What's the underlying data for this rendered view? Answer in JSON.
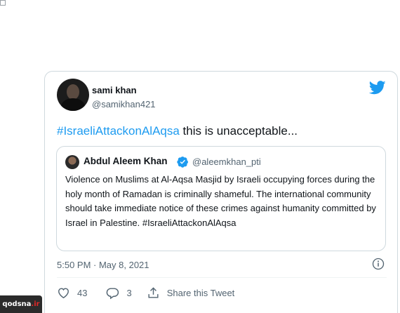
{
  "tweet": {
    "author_name": "sami khan",
    "author_handle": "@samikhan421",
    "hashtag": "#IsraeliAttackonAlAqsa",
    "text_after_hashtag": " this is unacceptable...",
    "timestamp": "5:50 PM · May 8, 2021",
    "likes": "43",
    "replies": "3",
    "share_label": "Share this Tweet"
  },
  "quoted_tweet": {
    "author_name": "Abdul Aleem Khan",
    "author_handle": "@aleemkhan_pti",
    "verified": true,
    "text": "Violence on Muslims at Al-Aqsa Masjid by Israeli occupying forces during the holy month of Ramadan is criminally shameful. The international community should take immediate notice of these crimes against humanity committed by Israel in Palestine. #IsraeliAttackonAlAqsa"
  },
  "watermark": {
    "brand": "qodsna",
    "suffix": ".ir"
  },
  "icons": [
    "twitter-bird-icon",
    "verified-badge-icon",
    "info-icon",
    "heart-icon",
    "reply-icon",
    "share-icon"
  ],
  "colors": {
    "accent": "#1d9bf0",
    "text": "#0f1419",
    "secondary": "#536471",
    "border": "#cfd9de"
  }
}
